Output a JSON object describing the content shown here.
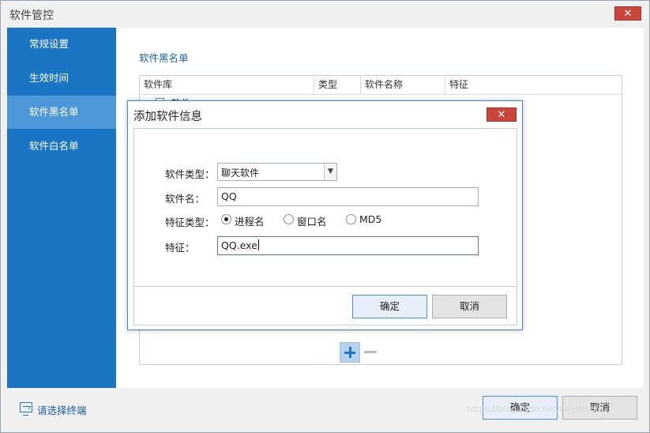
{
  "window": {
    "title": "软件管控",
    "close_glyph": "✕"
  },
  "sidebar": {
    "items": [
      {
        "label": "常规设置"
      },
      {
        "label": "生效时间"
      },
      {
        "label": "软件黑名单"
      },
      {
        "label": "软件白名单"
      }
    ],
    "active_index": 2
  },
  "main": {
    "section_title": "软件黑名单",
    "table": {
      "columns": [
        "软件库",
        "类型",
        "软件名称",
        "特征"
      ],
      "tree": [
        {
          "label": "软件",
          "checked": false
        }
      ]
    },
    "add_icon": "plus-icon",
    "remove_icon": "minus-icon"
  },
  "footer": {
    "terminal_link": "请选择终端",
    "ok_label": "确定",
    "cancel_label": "取消"
  },
  "dialog": {
    "title": "添加软件信息",
    "close_glyph": "✕",
    "fields": {
      "type_label": "软件类型：",
      "type_value": "聊天软件",
      "name_label": "软件名：",
      "name_value": "QQ",
      "feature_type_label": "特征类型：",
      "feature_label": "特征：",
      "feature_value": "QQ.exe"
    },
    "feature_types": [
      {
        "label": "进程名",
        "checked": true
      },
      {
        "label": "窗口名",
        "checked": false
      },
      {
        "label": "MD5",
        "checked": false
      }
    ],
    "ok_label": "确定",
    "cancel_label": "取消"
  },
  "watermark": "https://blog.csdn.net/overbegin",
  "colors": {
    "sidebar": "#1a76c5",
    "sidebar_active": "#4c97d8",
    "accent_text": "#1a5fa7",
    "close_button": "#c8463b"
  }
}
